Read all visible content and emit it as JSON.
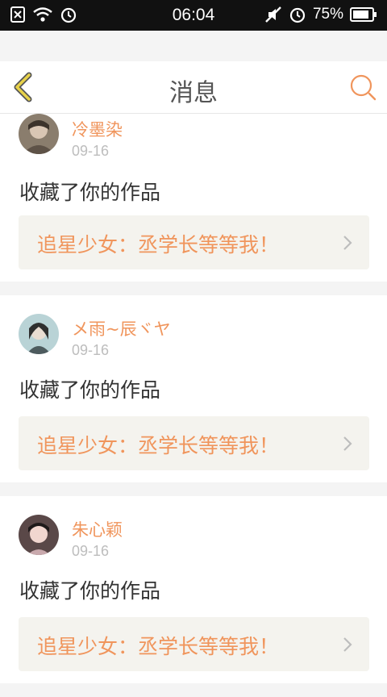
{
  "status": {
    "time": "06:04",
    "battery": "75%"
  },
  "header": {
    "title": "消息"
  },
  "messages": [
    {
      "user": "冷墨染",
      "date": "09-16",
      "action": "收藏了你的作品",
      "work": "追星少女：丞学长等等我！"
    },
    {
      "user": "メ雨~辰ヾヤ",
      "date": "09-16",
      "action": "收藏了你的作品",
      "work": "追星少女：丞学长等等我！"
    },
    {
      "user": "朱心颖",
      "date": "09-16",
      "action": "收藏了你的作品",
      "work": "追星少女：丞学长等等我！"
    }
  ],
  "colors": {
    "accent": "#f0955c",
    "back_icon": "#e8d24a"
  }
}
